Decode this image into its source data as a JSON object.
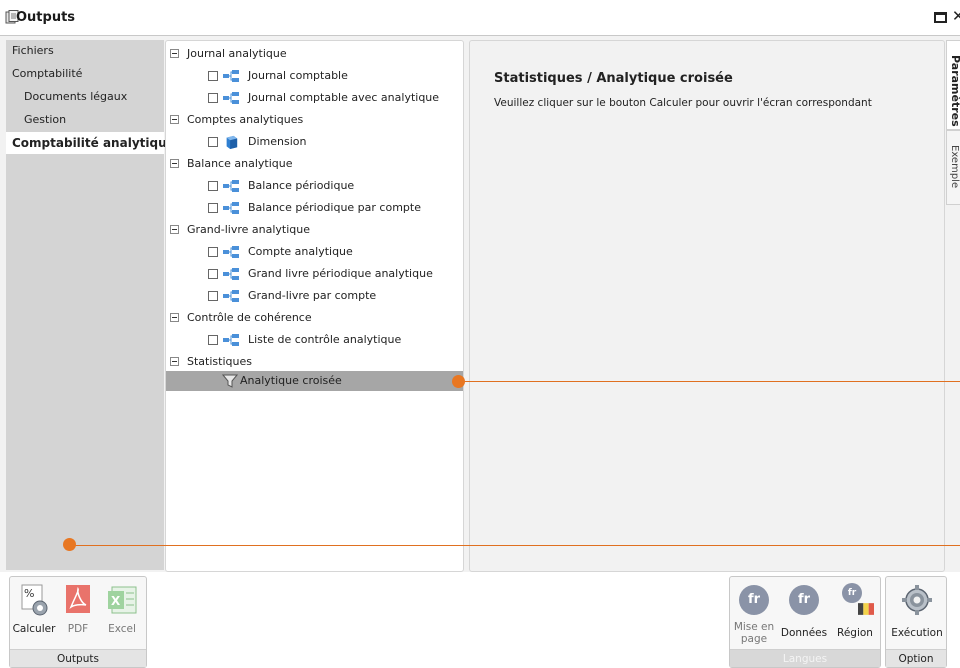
{
  "window": {
    "title": "Outputs"
  },
  "nav": {
    "items": [
      {
        "label": "Fichiers"
      },
      {
        "label": "Comptabilité"
      },
      {
        "label": "Documents légaux"
      },
      {
        "label": "Gestion"
      },
      {
        "label": "Comptabilité analytique"
      }
    ]
  },
  "tree": {
    "groups": [
      {
        "label": "Journal analytique",
        "items": [
          {
            "label": "Journal comptable",
            "icon": "report-tree-icon"
          },
          {
            "label": "Journal comptable avec analytique",
            "icon": "report-tree-icon"
          }
        ]
      },
      {
        "label": "Comptes analytiques",
        "items": [
          {
            "label": "Dimension",
            "icon": "cube-icon"
          }
        ]
      },
      {
        "label": "Balance analytique",
        "items": [
          {
            "label": "Balance périodique",
            "icon": "report-tree-icon"
          },
          {
            "label": "Balance périodique par compte",
            "icon": "report-tree-icon"
          }
        ]
      },
      {
        "label": "Grand-livre analytique",
        "items": [
          {
            "label": "Compte analytique",
            "icon": "report-tree-icon"
          },
          {
            "label": "Grand livre périodique analytique",
            "icon": "report-tree-icon"
          },
          {
            "label": "Grand-livre par compte",
            "icon": "report-tree-icon"
          }
        ]
      },
      {
        "label": "Contrôle de cohérence",
        "items": [
          {
            "label": "Liste de contrôle analytique",
            "icon": "report-tree-icon"
          }
        ]
      },
      {
        "label": "Statistiques",
        "items": [
          {
            "label": "Analytique croisée",
            "icon": "funnel-icon"
          }
        ]
      }
    ]
  },
  "detail": {
    "title": "Statistiques / Analytique croisée",
    "text": "Veuillez cliquer sur le bouton Calculer pour ouvrir l'écran correspondant"
  },
  "side_tabs": [
    {
      "label": "Paramètres"
    },
    {
      "label": "Exemple"
    }
  ],
  "ribbon": {
    "outputs": {
      "label": "Outputs",
      "buttons": [
        {
          "label": "Calculer"
        },
        {
          "label": "PDF"
        },
        {
          "label": "Excel"
        }
      ]
    },
    "langues": {
      "label": "Langues",
      "buttons": [
        {
          "label": "Mise en page",
          "badge": "fr"
        },
        {
          "label": "Données",
          "badge": "fr"
        },
        {
          "label": "Région",
          "badge": "fr"
        }
      ]
    },
    "option": {
      "label": "Option",
      "buttons": [
        {
          "label": "Exécution"
        }
      ]
    }
  },
  "colors": {
    "accent": "#e87722",
    "selected_row": "#a6a6a6",
    "nav_bg": "#d4d4d4"
  }
}
